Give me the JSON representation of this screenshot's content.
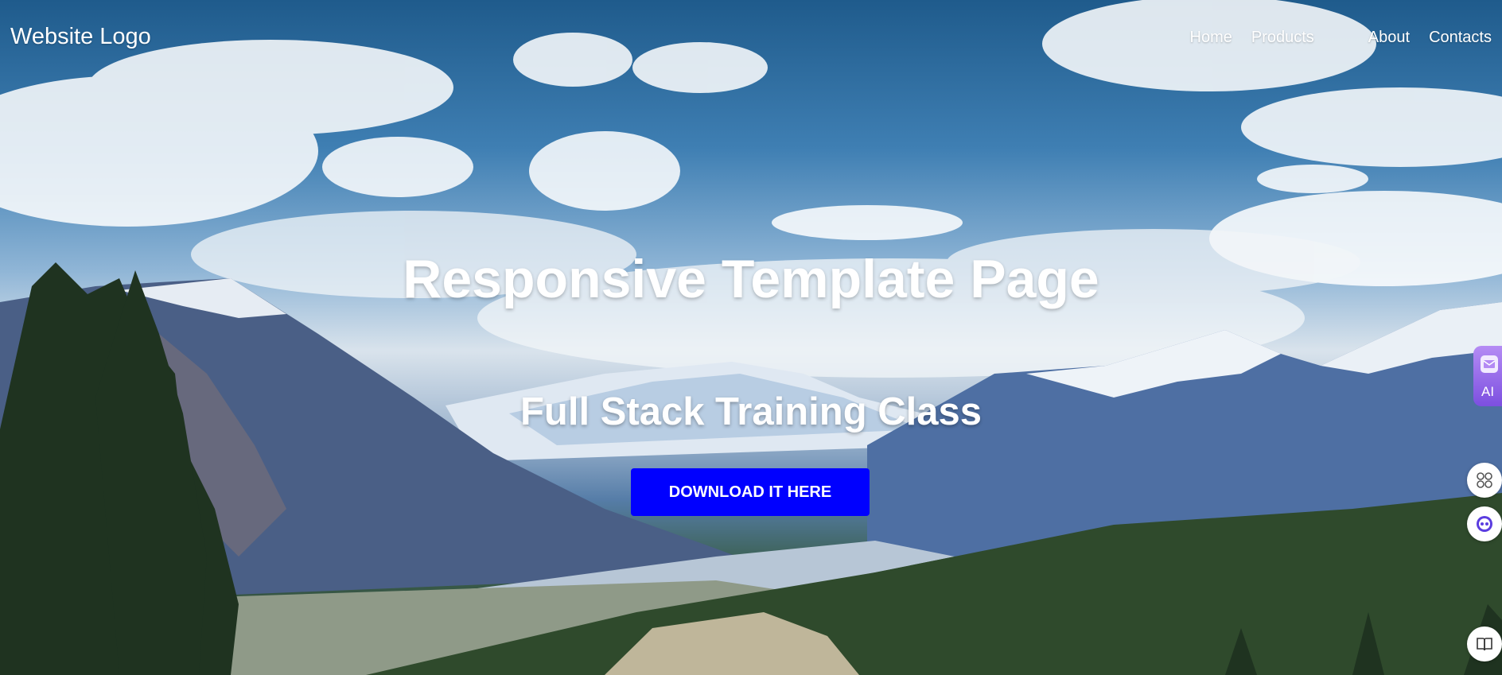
{
  "header": {
    "logo_text": "Website Logo",
    "nav": [
      "Home",
      "Products",
      "About",
      "Contacts"
    ]
  },
  "hero": {
    "title": "Responsive Template Page",
    "subtitle": "Full Stack Training Class",
    "cta_label": "DOWNLOAD IT HERE",
    "cta_color": "#0000ff",
    "background": "mountain-valley-photo"
  },
  "side_widgets": {
    "ai_label": "AI",
    "icons": [
      "mail-icon",
      "apps-grid-icon",
      "assistant-icon",
      "book-icon"
    ],
    "ai_color": "#9a6cf0"
  }
}
